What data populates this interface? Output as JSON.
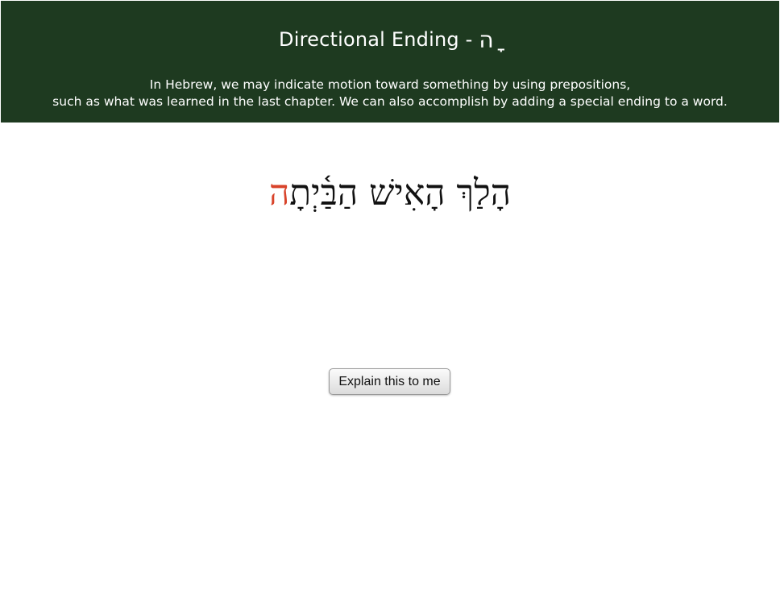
{
  "header": {
    "title": "Directional Ending -",
    "title_suffix": "ה ָ",
    "intro_line_1": "In Hebrew, we may indicate motion toward something by using prepositions,",
    "intro_line_2": "such as what was learned in the last chapter. We can also accomplish by adding a special ending to a word."
  },
  "example": {
    "sentence_main": "הָלַךְ הָאִישׁ הַבַּ֫יְתָ",
    "sentence_ending": "ה"
  },
  "explain_button": {
    "label": "Explain this to me"
  },
  "colors": {
    "header_bg": "#1e3a20",
    "highlight": "#d8432a"
  }
}
